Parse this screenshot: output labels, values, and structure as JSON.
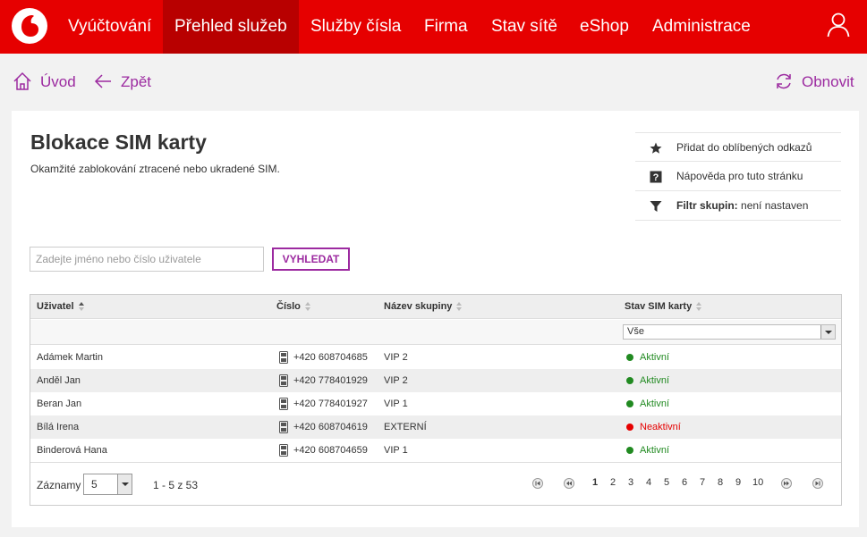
{
  "nav": {
    "items": [
      {
        "label": "Vyúčtování"
      },
      {
        "label": "Přehled služeb",
        "active": true
      },
      {
        "label": "Služby čísla"
      },
      {
        "label": "Firma"
      },
      {
        "label": "Stav sítě"
      },
      {
        "label": "eShop"
      },
      {
        "label": "Administrace"
      }
    ]
  },
  "subnav": {
    "home": "Úvod",
    "back": "Zpět",
    "refresh": "Obnovit"
  },
  "page": {
    "title": "Blokace SIM karty",
    "description": "Okamžité zablokování ztracené nebo ukradené SIM."
  },
  "side_actions": {
    "favorite": "Přidat do oblíbených odkazů",
    "help": "Nápověda pro tuto stránku",
    "filter_label": "Filtr skupin:",
    "filter_value": "není nastaven"
  },
  "search": {
    "placeholder": "Zadejte jméno nebo číslo uživatele",
    "button": "VYHLEDAT"
  },
  "table": {
    "columns": [
      "Uživatel",
      "Číslo",
      "Název skupiny",
      "Stav SIM karty"
    ],
    "status_filter": "Vše",
    "rows": [
      {
        "user": "Adámek Martin",
        "number": "+420 608704685",
        "group": "VIP 2",
        "status": "Aktivní"
      },
      {
        "user": "Anděl Jan",
        "number": "+420 778401929",
        "group": "VIP 2",
        "status": "Aktivní"
      },
      {
        "user": "Beran Jan",
        "number": "+420 778401927",
        "group": "VIP 1",
        "status": "Aktivní"
      },
      {
        "user": "Bílá Irena",
        "number": "+420 608704619",
        "group": "EXTERNÍ",
        "status": "Neaktivní"
      },
      {
        "user": "Binderová Hana",
        "number": "+420 608704659",
        "group": "VIP 1",
        "status": "Aktivní"
      }
    ]
  },
  "pager": {
    "label": "Záznamy",
    "page_size": "5",
    "range": "1 - 5 z 53",
    "pages": [
      "1",
      "2",
      "3",
      "4",
      "5",
      "6",
      "7",
      "8",
      "9",
      "10"
    ],
    "current": "1"
  },
  "colors": {
    "brand": "#e60000",
    "nav_active": "#b80000",
    "accent": "#9c2aa0",
    "active_status": "#218a21",
    "inactive_status": "#e60000"
  }
}
